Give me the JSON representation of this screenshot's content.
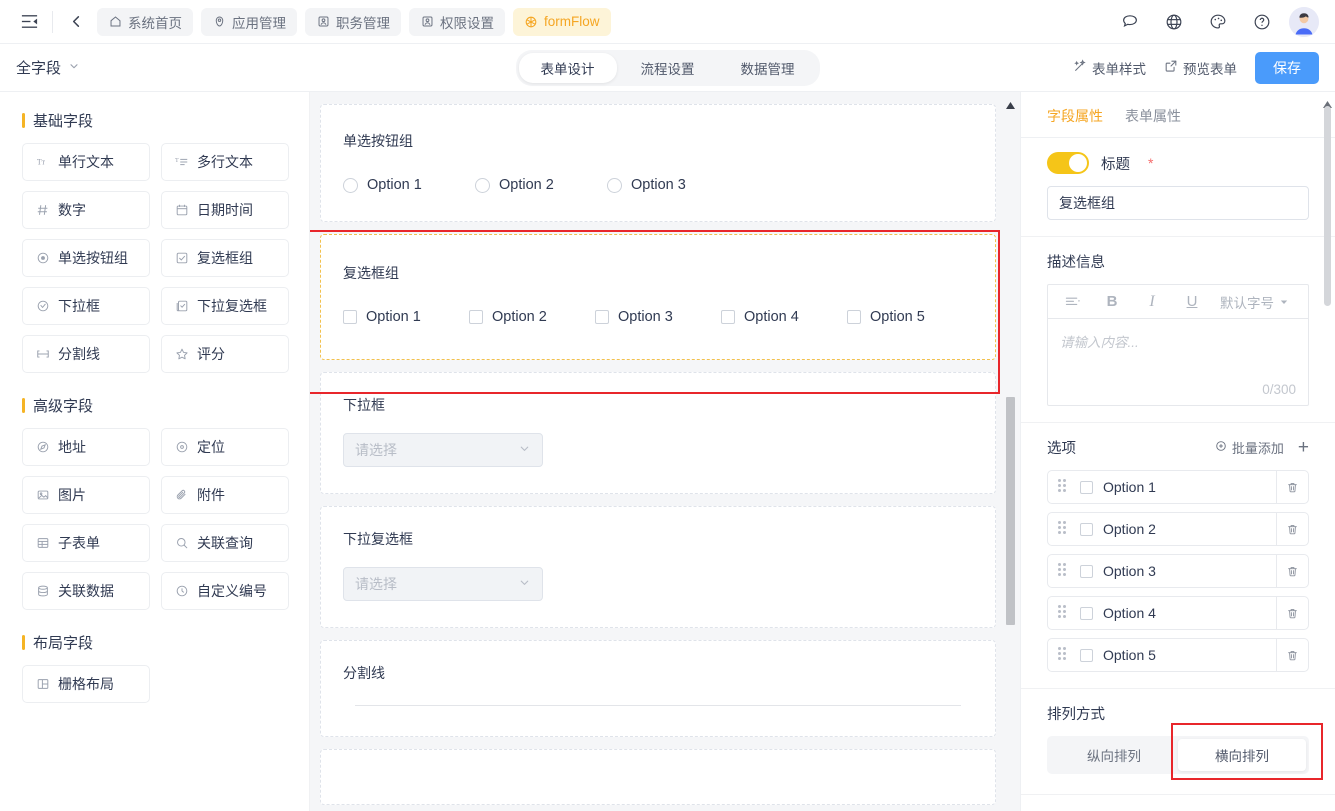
{
  "header": {
    "collapse_icon": "sidebar-collapse-icon",
    "back_icon": "chevron-left-icon",
    "nav_tabs": [
      {
        "label": "系统首页",
        "icon": "home-icon",
        "active": false
      },
      {
        "label": "应用管理",
        "icon": "apps-icon",
        "active": false
      },
      {
        "label": "职务管理",
        "icon": "user-card-icon",
        "active": false
      },
      {
        "label": "权限设置",
        "icon": "user-card-icon",
        "active": false
      },
      {
        "label": "formFlow",
        "icon": "flow-icon",
        "active": true
      }
    ],
    "icons": [
      "chat-icon",
      "globe-icon",
      "palette-icon",
      "help-icon"
    ],
    "avatar": "user-avatar"
  },
  "toolbar": {
    "field_scope": "全字段",
    "tabs": [
      {
        "label": "表单设计",
        "active": true
      },
      {
        "label": "流程设置",
        "active": false
      },
      {
        "label": "数据管理",
        "active": false
      }
    ],
    "form_style_label": "表单样式",
    "preview_label": "预览表单",
    "save_label": "保存"
  },
  "palette": {
    "groups": [
      {
        "title": "基础字段",
        "items": [
          {
            "label": "单行文本",
            "icon": "text-single-icon"
          },
          {
            "label": "多行文本",
            "icon": "text-multi-icon"
          },
          {
            "label": "数字",
            "icon": "hash-icon"
          },
          {
            "label": "日期时间",
            "icon": "calendar-icon"
          },
          {
            "label": "单选按钮组",
            "icon": "radio-icon"
          },
          {
            "label": "复选框组",
            "icon": "checkbox-icon"
          },
          {
            "label": "下拉框",
            "icon": "dropdown-icon"
          },
          {
            "label": "下拉复选框",
            "icon": "dropdown-multi-icon"
          },
          {
            "label": "分割线",
            "icon": "divider-icon"
          },
          {
            "label": "评分",
            "icon": "star-icon"
          }
        ]
      },
      {
        "title": "高级字段",
        "items": [
          {
            "label": "地址",
            "icon": "address-icon"
          },
          {
            "label": "定位",
            "icon": "location-icon"
          },
          {
            "label": "图片",
            "icon": "image-icon"
          },
          {
            "label": "附件",
            "icon": "attachment-icon"
          },
          {
            "label": "子表单",
            "icon": "subtable-icon"
          },
          {
            "label": "关联查询",
            "icon": "search-icon"
          },
          {
            "label": "关联数据",
            "icon": "database-icon"
          },
          {
            "label": "自定义编号",
            "icon": "number-icon"
          }
        ]
      },
      {
        "title": "布局字段",
        "items": [
          {
            "label": "栅格布局",
            "icon": "grid-icon"
          }
        ]
      }
    ]
  },
  "canvas": {
    "fields": [
      {
        "type": "radio",
        "label": "单选按钮组",
        "selected": false,
        "options": [
          "Option 1",
          "Option 2",
          "Option 3"
        ]
      },
      {
        "type": "checkbox",
        "label": "复选框组",
        "selected": true,
        "options": [
          "Option 1",
          "Option 2",
          "Option 3",
          "Option 4",
          "Option 5"
        ]
      },
      {
        "type": "select",
        "label": "下拉框",
        "selected": false,
        "placeholder": "请选择"
      },
      {
        "type": "multiselect",
        "label": "下拉复选框",
        "selected": false,
        "placeholder": "请选择"
      },
      {
        "type": "divider",
        "label": "分割线",
        "selected": false
      }
    ]
  },
  "props": {
    "tabs": [
      {
        "label": "字段属性",
        "active": true
      },
      {
        "label": "表单属性",
        "active": false
      }
    ],
    "title_section": {
      "toggle_on": true,
      "label": "标题",
      "required_mark": "*",
      "value": "复选框组"
    },
    "desc_section": {
      "label": "描述信息",
      "toolbar": {
        "align": "align-left-icon",
        "bold": "B",
        "italic": "I",
        "underline": "U",
        "font_size": "默认字号"
      },
      "placeholder": "请输入内容...",
      "counter": "0/300"
    },
    "options_section": {
      "label": "选项",
      "batch_add": "批量添加",
      "add_icon": "plus-icon",
      "items": [
        {
          "text": "Option 1",
          "checked": false
        },
        {
          "text": "Option 2",
          "checked": false
        },
        {
          "text": "Option 3",
          "checked": false
        },
        {
          "text": "Option 4",
          "checked": false
        },
        {
          "text": "Option 5",
          "checked": false
        }
      ],
      "delete_icon": "trash-icon",
      "drag_icon": "drag-handle-icon"
    },
    "layout_section": {
      "label": "排列方式",
      "options": [
        {
          "label": "纵向排列",
          "active": false
        },
        {
          "label": "横向排列",
          "active": true
        }
      ],
      "highlighted": "横向排列"
    }
  },
  "colors": {
    "accent_yellow": "#f5a623",
    "primary_blue": "#4a9bfb",
    "highlight_red": "#e8262b",
    "selected_border": "#f2c14e"
  }
}
